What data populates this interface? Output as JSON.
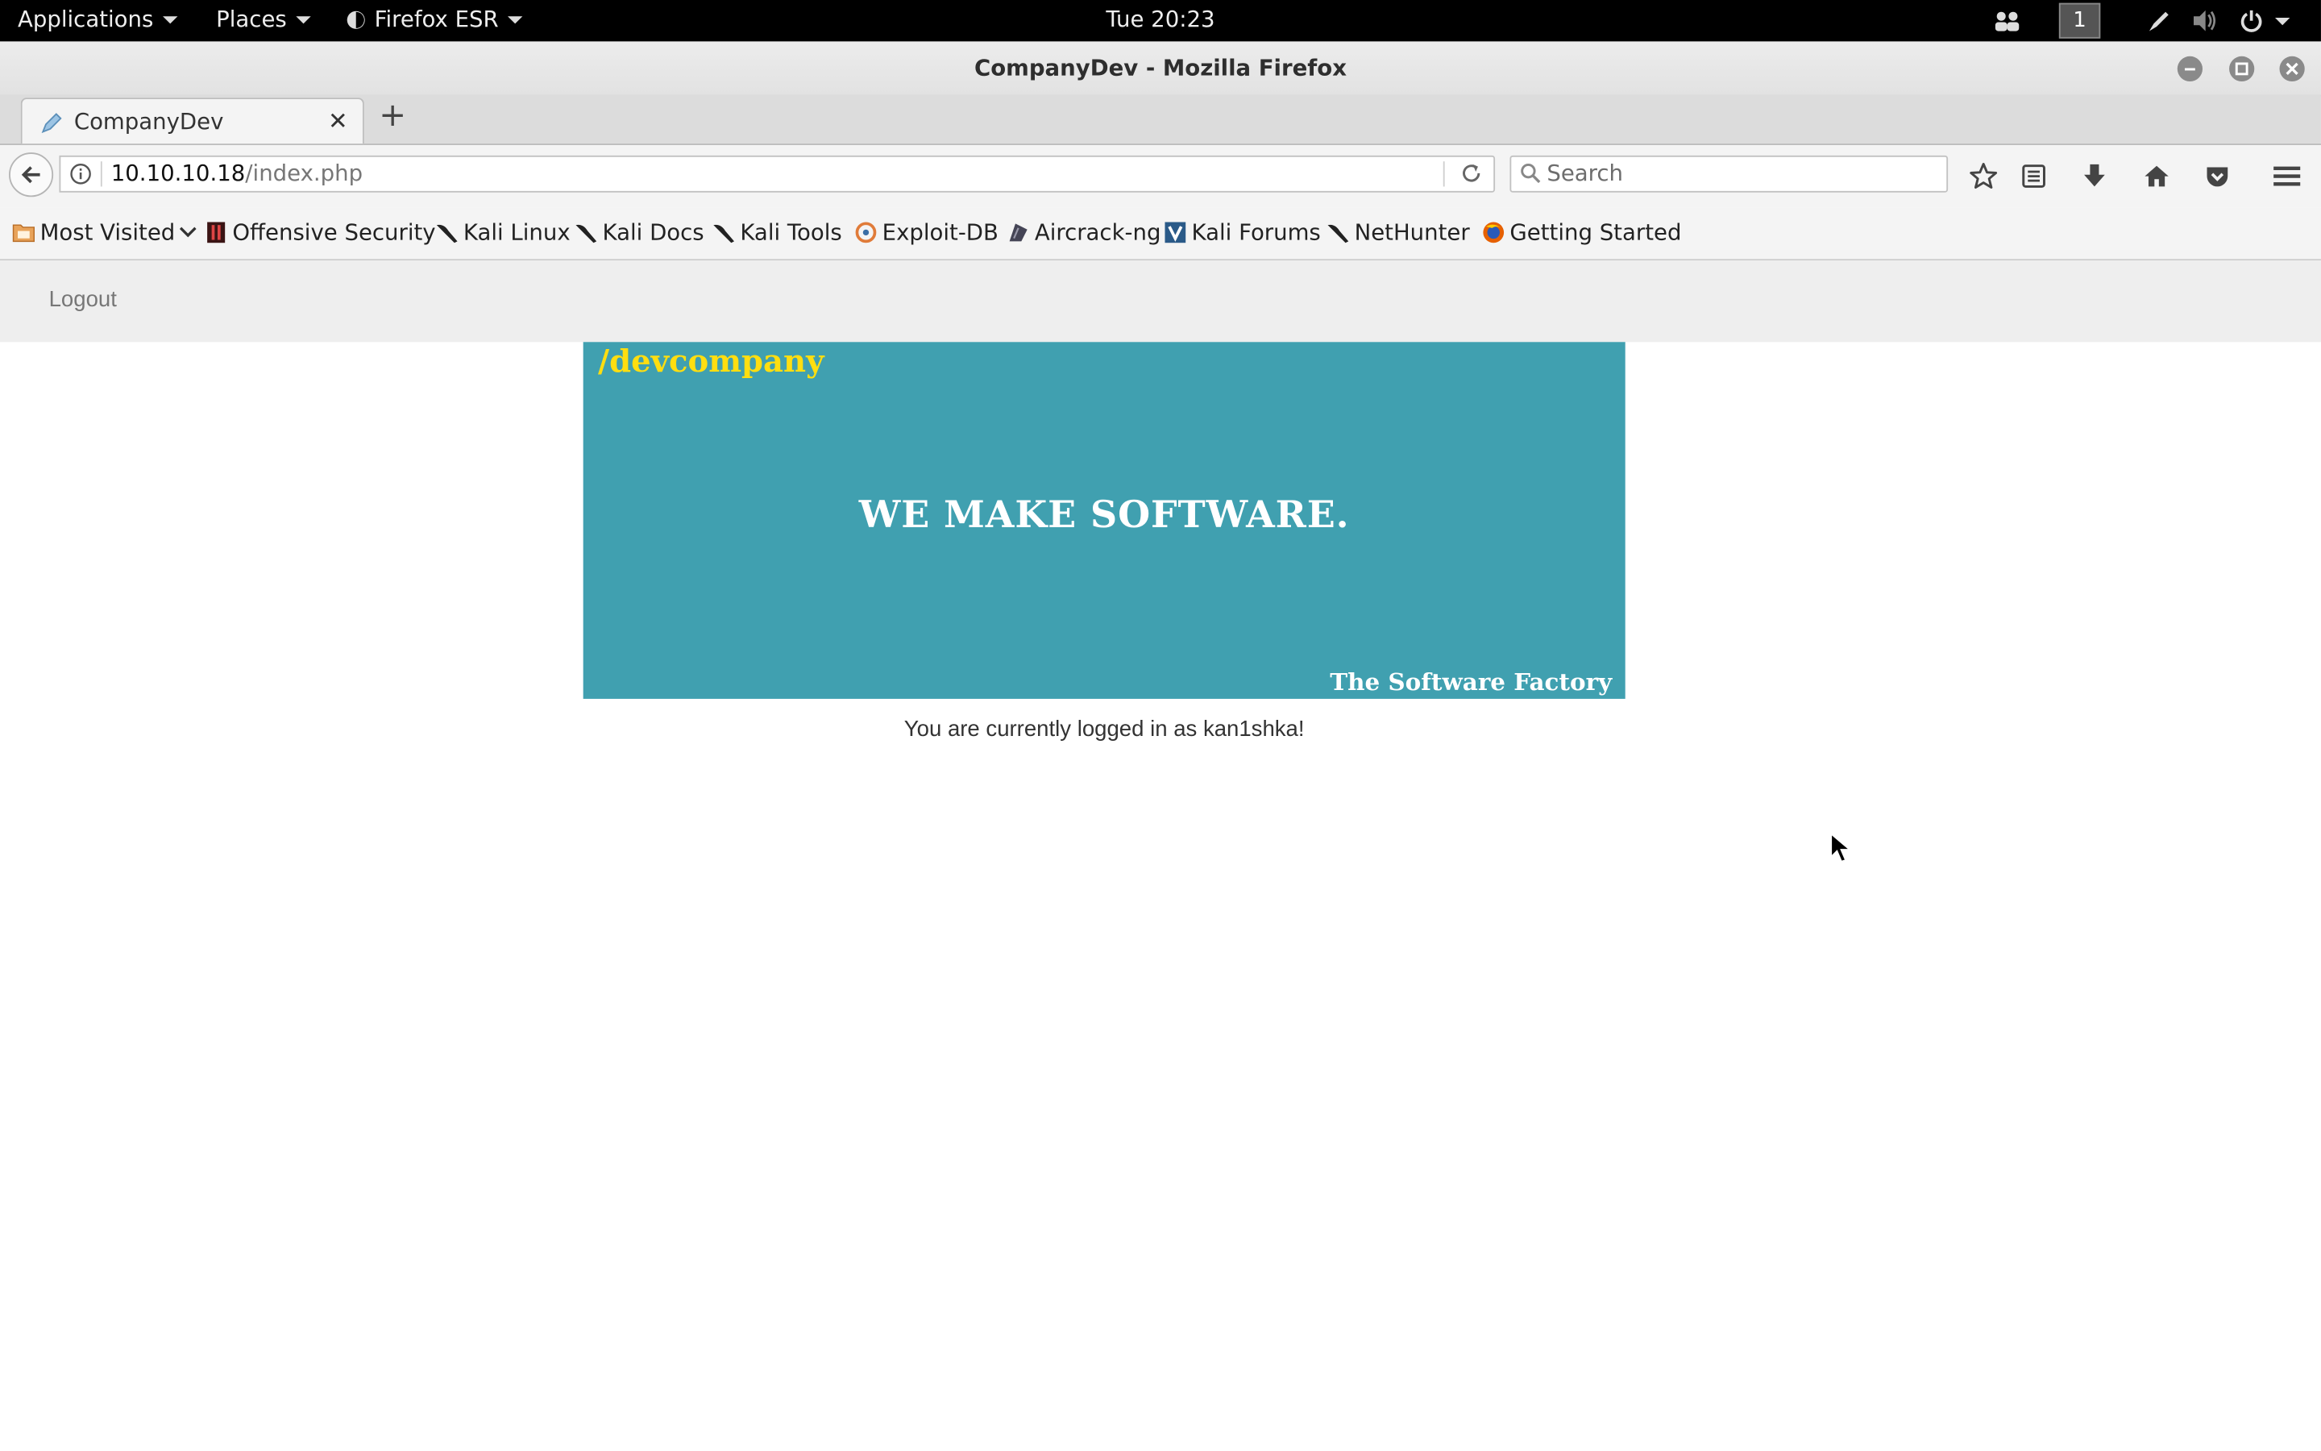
{
  "system_bar": {
    "applications": "Applications",
    "places": "Places",
    "firefox_menu": "Firefox ESR",
    "clock": "Tue 20:23",
    "workspace": "1"
  },
  "window": {
    "title": "CompanyDev - Mozilla Firefox"
  },
  "tab": {
    "label": "CompanyDev"
  },
  "navbar": {
    "url_host": "10.10.10.18",
    "url_path": "/index.php",
    "search_placeholder": "Search"
  },
  "bookmarks": [
    {
      "label": "Most Visited",
      "icon": "folder-icon"
    },
    {
      "label": "Offensive Security",
      "icon": "offsec-icon"
    },
    {
      "label": "Kali Linux",
      "icon": "kali-icon"
    },
    {
      "label": "Kali Docs",
      "icon": "kali-icon"
    },
    {
      "label": "Kali Tools",
      "icon": "kali-icon"
    },
    {
      "label": "Exploit-DB",
      "icon": "exploitdb-icon"
    },
    {
      "label": "Aircrack-ng",
      "icon": "aircrack-icon"
    },
    {
      "label": "Kali Forums",
      "icon": "forums-icon"
    },
    {
      "label": "NetHunter",
      "icon": "kali-icon"
    },
    {
      "label": "Getting Started",
      "icon": "firefox-icon"
    }
  ],
  "page": {
    "logout": "Logout",
    "banner_brand": "/devcompany",
    "banner_headline": "WE MAKE SOFTWARE.",
    "banner_tagline": "The Software Factory",
    "logged_message": "You are currently logged in as kan1shka!"
  },
  "colors": {
    "banner_bg": "#40a0b0",
    "brand_yellow": "#ffde10",
    "topbar": "#000000"
  }
}
